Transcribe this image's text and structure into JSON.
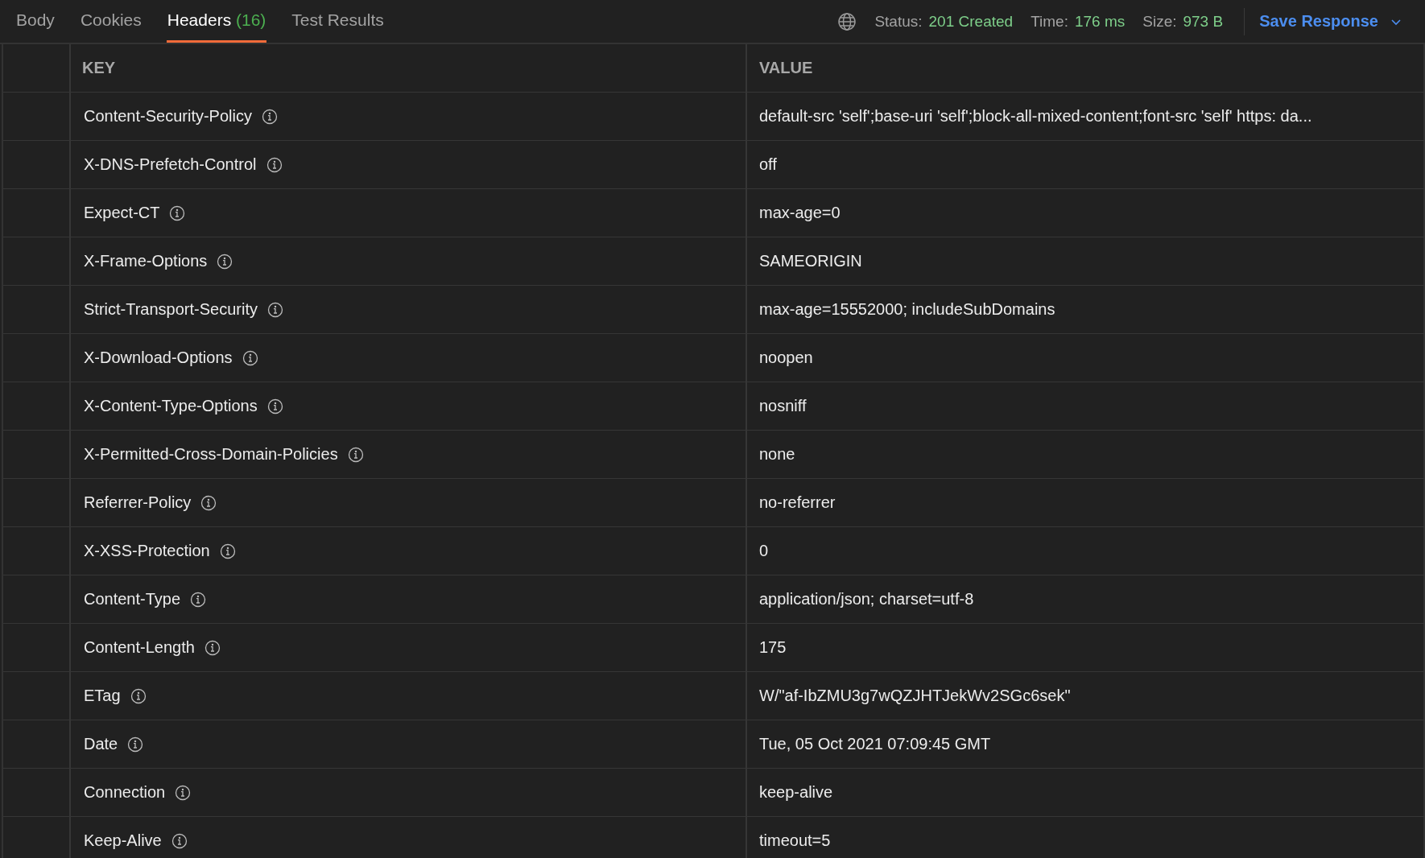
{
  "tabs": [
    {
      "label": "Body",
      "selected": false
    },
    {
      "label": "Cookies",
      "selected": false
    },
    {
      "label": "Headers",
      "count": "(16)",
      "selected": true
    },
    {
      "label": "Test Results",
      "selected": false
    }
  ],
  "stats": [
    {
      "label": "Status:",
      "value": "201 Created"
    },
    {
      "label": "Time:",
      "value": "176 ms"
    },
    {
      "label": "Size:",
      "value": "973 B"
    }
  ],
  "save_button": {
    "label": "Save Response"
  },
  "table": {
    "columns": [
      "KEY",
      "VALUE"
    ],
    "rows": [
      {
        "key": "Content-Security-Policy",
        "value": "default-src 'self';base-uri 'self';block-all-mixed-content;font-src 'self' https: da..."
      },
      {
        "key": "X-DNS-Prefetch-Control",
        "value": "off"
      },
      {
        "key": "Expect-CT",
        "value": "max-age=0"
      },
      {
        "key": "X-Frame-Options",
        "value": "SAMEORIGIN"
      },
      {
        "key": "Strict-Transport-Security",
        "value": "max-age=15552000; includeSubDomains"
      },
      {
        "key": "X-Download-Options",
        "value": "noopen"
      },
      {
        "key": "X-Content-Type-Options",
        "value": "nosniff"
      },
      {
        "key": "X-Permitted-Cross-Domain-Policies",
        "value": "none"
      },
      {
        "key": "Referrer-Policy",
        "value": "no-referrer"
      },
      {
        "key": "X-XSS-Protection",
        "value": "0"
      },
      {
        "key": "Content-Type",
        "value": "application/json; charset=utf-8"
      },
      {
        "key": "Content-Length",
        "value": "175"
      },
      {
        "key": "ETag",
        "value": "W/\"af-IbZMU3g7wQZJHTJekWv2SGc6sek\""
      },
      {
        "key": "Date",
        "value": "Tue, 05 Oct 2021 07:09:45 GMT"
      },
      {
        "key": "Connection",
        "value": "keep-alive"
      },
      {
        "key": "Keep-Alive",
        "value": "timeout=5"
      }
    ]
  }
}
